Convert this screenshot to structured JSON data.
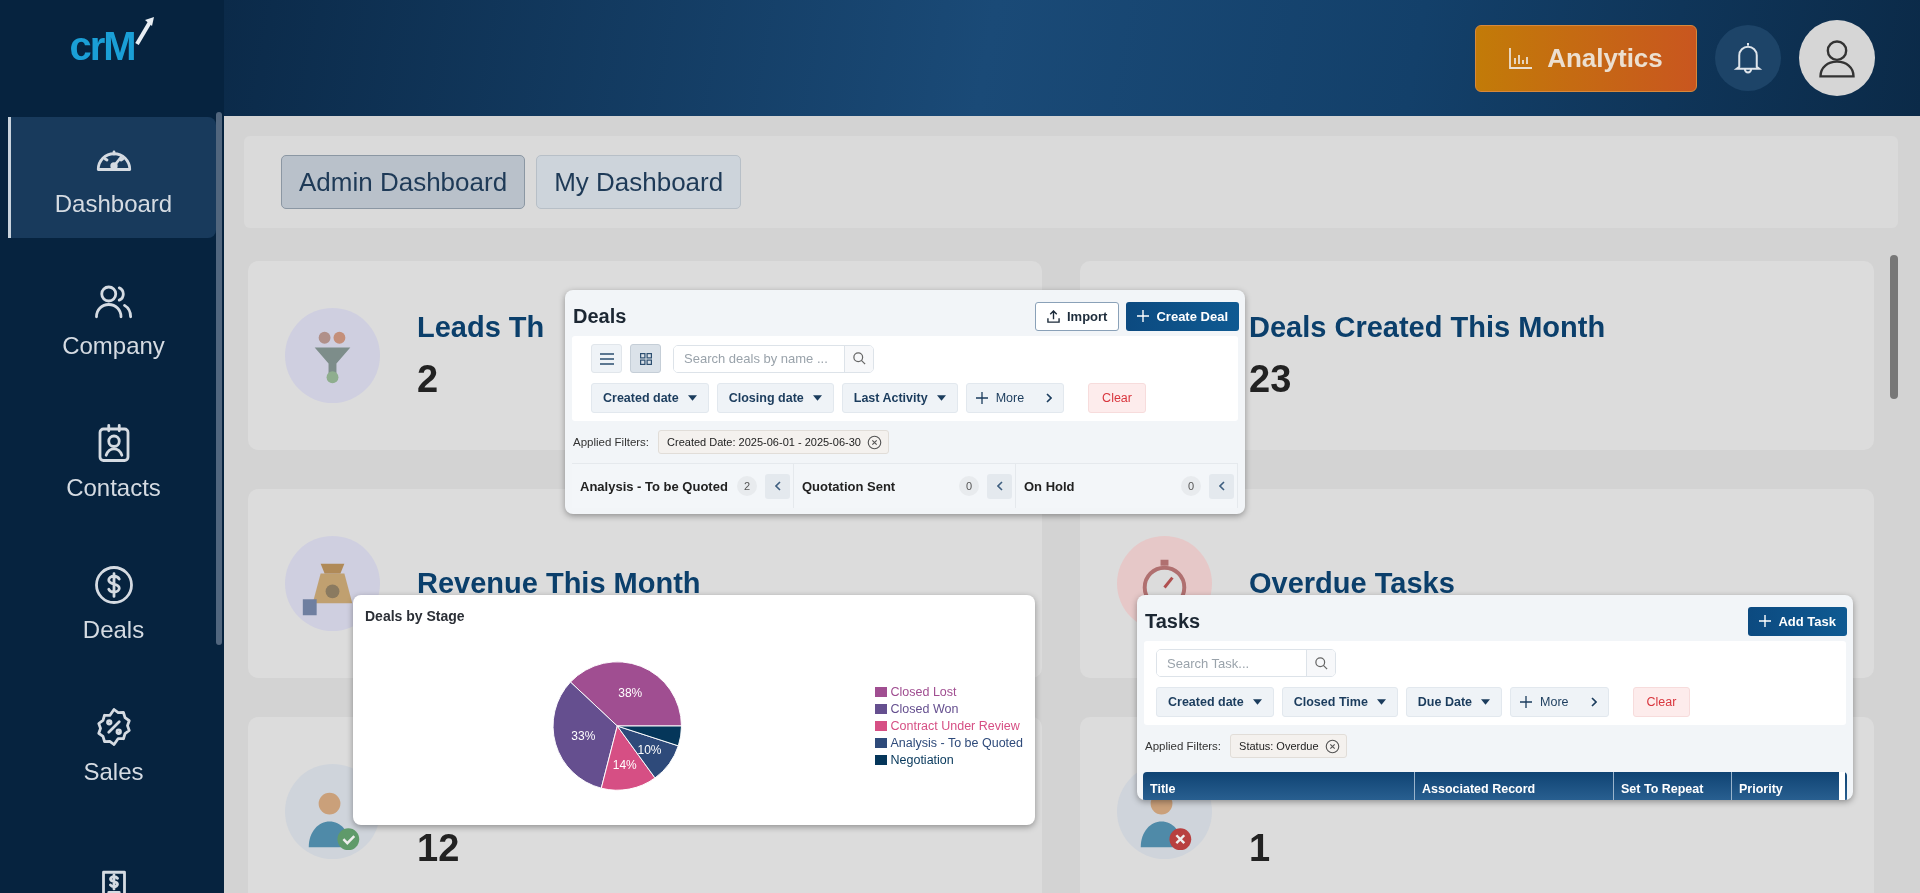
{
  "sidebar": {
    "logo": "crM",
    "items": [
      {
        "label": "Dashboard",
        "selected": true
      },
      {
        "label": "Company",
        "selected": false
      },
      {
        "label": "Contacts",
        "selected": false
      },
      {
        "label": "Deals",
        "selected": false
      },
      {
        "label": "Sales",
        "selected": false
      },
      {
        "selected": false
      }
    ]
  },
  "header": {
    "analytics_button": "Analytics"
  },
  "dashboard_tabs": [
    {
      "label": "Admin Dashboard",
      "selected": true
    },
    {
      "label": "My Dashboard",
      "selected": false
    }
  ],
  "cards": [
    {
      "title": "Leads Th",
      "value": "2"
    },
    {
      "title": "Deals Created This Month",
      "value": "23"
    },
    {
      "title": "Revenue This Month"
    },
    {
      "title": "Overdue Tasks"
    },
    {
      "value": "12"
    },
    {
      "value": "1"
    }
  ],
  "deals_panel": {
    "title": "Deals",
    "import_button": "Import",
    "create_button": "Create Deal",
    "view_toggles": [
      {
        "kind": "list",
        "selected": false
      },
      {
        "kind": "grid",
        "selected": true
      }
    ],
    "search": {
      "placeholder": "Search deals by name ..."
    },
    "filters": [
      {
        "kind": "dropdown",
        "label": "Created date"
      },
      {
        "kind": "dropdown",
        "label": "Closing date"
      },
      {
        "kind": "dropdown",
        "label": "Last Activity"
      },
      {
        "kind": "more",
        "label": "More"
      },
      {
        "kind": "clear",
        "label": "Clear"
      }
    ],
    "applied_filters_label": "Applied Filters:",
    "applied_filters": [
      "Created Date: 2025-06-01 - 2025-06-30"
    ],
    "columns": [
      {
        "name": "Analysis - To be Quoted",
        "count": "2"
      },
      {
        "name": "Quotation Sent",
        "count": "0"
      },
      {
        "name": "On Hold",
        "count": "0"
      }
    ]
  },
  "stage_chart": {
    "chart_data": {
      "type": "pie",
      "title": "Deals by Stage",
      "categories": [
        "Closed Lost",
        "Closed Won",
        "Contract Under Review",
        "Analysis - To be Quoted",
        "Negotiation"
      ],
      "values": [
        38,
        33,
        14,
        10,
        5
      ],
      "colors": [
        "#a04e91",
        "#654f8f",
        "#d64f84",
        "#2e4a7a",
        "#05365a"
      ],
      "value_labels": [
        "38%",
        "33%",
        "14%",
        "10%",
        null
      ]
    }
  },
  "tasks_panel": {
    "title": "Tasks",
    "add_button": "Add Task",
    "search": {
      "placeholder": "Search Task..."
    },
    "filters": [
      {
        "kind": "dropdown",
        "label": "Created date"
      },
      {
        "kind": "dropdown",
        "label": "Closed Time"
      },
      {
        "kind": "dropdown",
        "label": "Due Date"
      },
      {
        "kind": "more",
        "label": "More"
      },
      {
        "kind": "clear",
        "label": "Clear"
      }
    ],
    "applied_filters_label": "Applied Filters:",
    "applied_filters": [
      "Status: Overdue"
    ],
    "table": {
      "columns": [
        "Title",
        "Associated Record",
        "Set To Repeat",
        "Priority"
      ]
    }
  }
}
